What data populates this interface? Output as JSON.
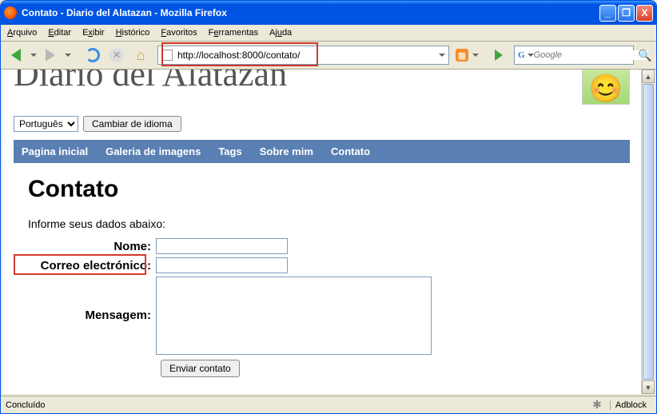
{
  "window": {
    "title": "Contato - Diario del Alatazan - Mozilla Firefox"
  },
  "menu": {
    "arquivo": "Arquivo",
    "editar": "Editar",
    "exibir": "Exibir",
    "historico": "Histórico",
    "favoritos": "Favoritos",
    "ferramentas": "Ferramentas",
    "ajuda": "Ajuda"
  },
  "toolbar": {
    "url": "http://localhost:8000/contato/",
    "search_placeholder": "Google"
  },
  "site": {
    "title": "Diario del Alatazan"
  },
  "lang": {
    "selected": "Português",
    "button": "Cambiar de idioma"
  },
  "nav": {
    "home": "Pagina inicial",
    "gallery": "Galeria de imagens",
    "tags": "Tags",
    "about": "Sobre mim",
    "contact": "Contato"
  },
  "page": {
    "heading": "Contato",
    "intro": "Informe seus dados abaixo:",
    "labels": {
      "nome": "Nome:",
      "email": "Correo electrónico:",
      "mensagem": "Mensagem:"
    },
    "submit": "Enviar contato"
  },
  "status": {
    "text": "Concluído",
    "adblock": "Adblock"
  }
}
